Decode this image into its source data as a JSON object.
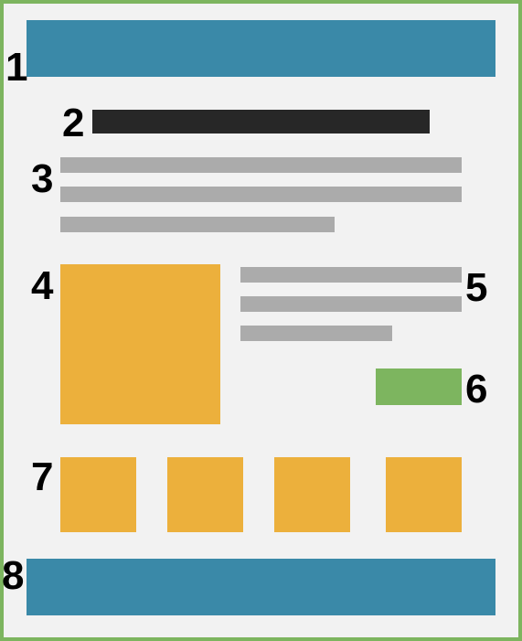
{
  "labels": {
    "header": "1",
    "title": "2",
    "intro": "3",
    "image": "4",
    "text": "5",
    "button": "6",
    "thumbnails": "7",
    "footer": "8"
  },
  "colors": {
    "border": "#7db55f",
    "background": "#f2f2f2",
    "header": "#3a89a8",
    "title": "#272727",
    "text_line": "#ababab",
    "image": "#ecb03c",
    "button": "#7db55f",
    "footer": "#3a89a8"
  }
}
